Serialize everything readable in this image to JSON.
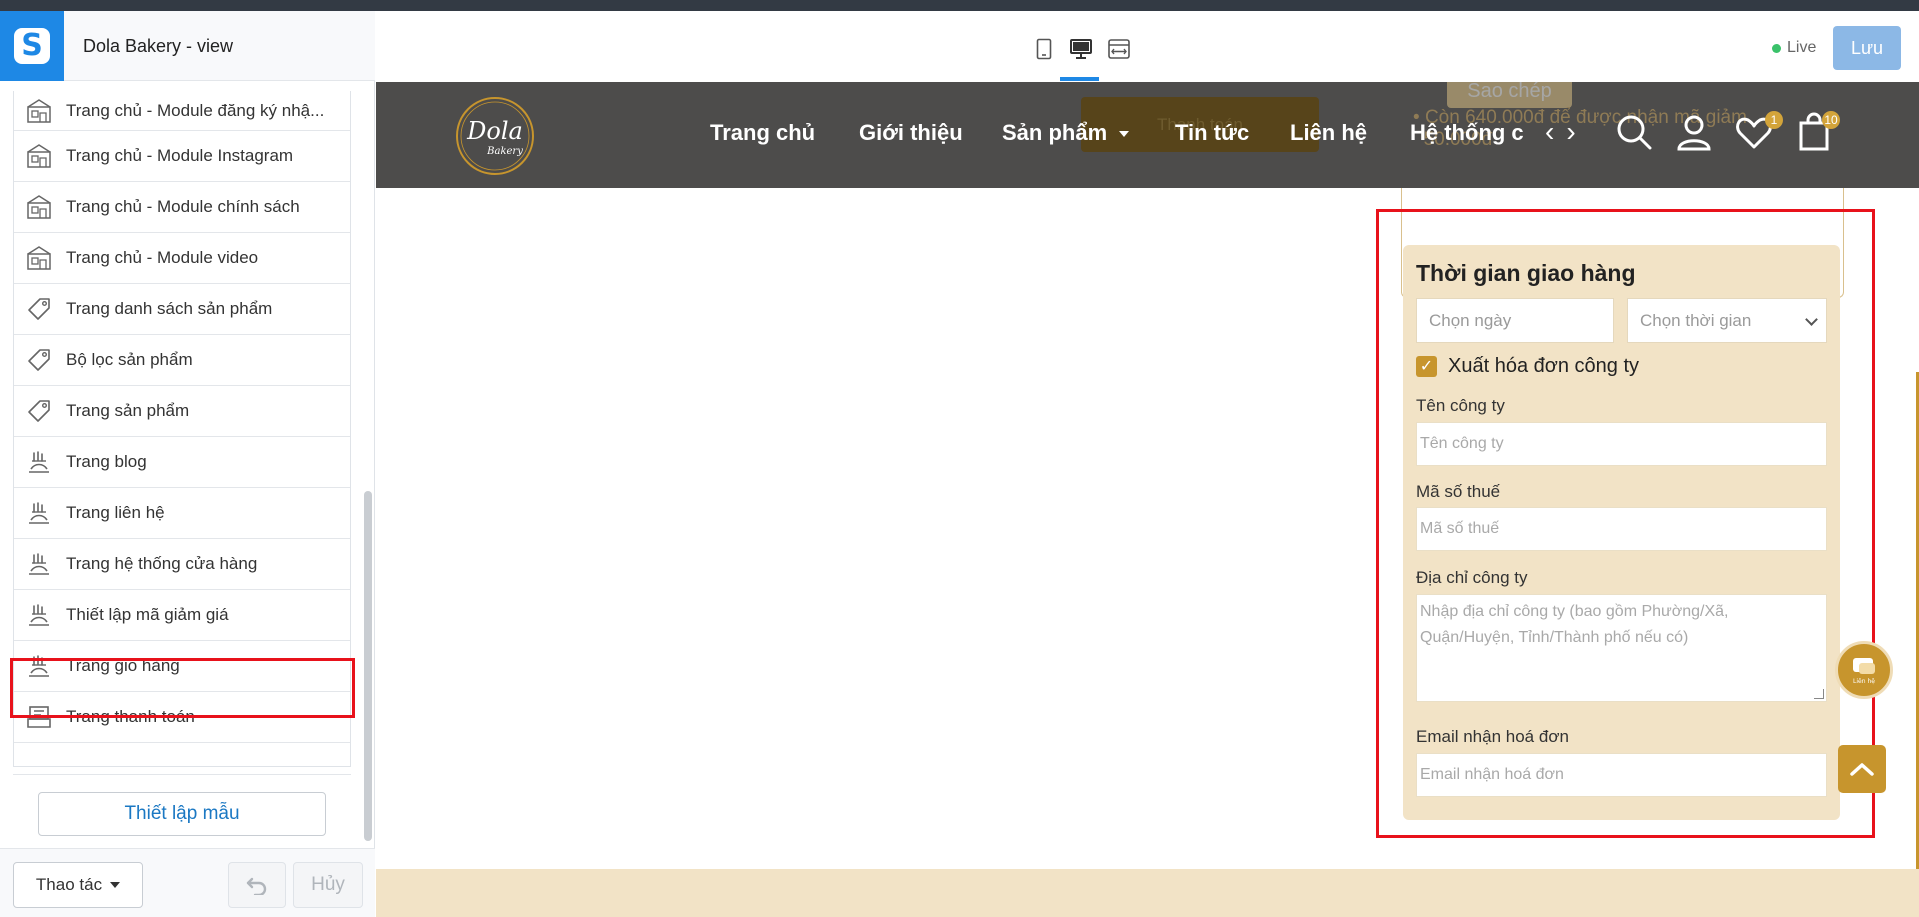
{
  "app": {
    "title": "Dola Bakery - view",
    "live_label": "Live",
    "save_label": "Lưu"
  },
  "sidebar": {
    "items": [
      {
        "label": "Trang chủ - Module đăng ký nhậ...",
        "icon": "home-icon"
      },
      {
        "label": "Trang chủ - Module Instagram",
        "icon": "home-icon"
      },
      {
        "label": "Trang chủ - Module chính sách",
        "icon": "home-icon"
      },
      {
        "label": "Trang chủ - Module video",
        "icon": "home-icon"
      },
      {
        "label": "Trang danh sách sản phẩm",
        "icon": "tag-icon"
      },
      {
        "label": "Bộ lọc sản phẩm",
        "icon": "tag-icon"
      },
      {
        "label": "Trang sản phẩm",
        "icon": "tag-icon"
      },
      {
        "label": "Trang blog",
        "icon": "blog-icon"
      },
      {
        "label": "Trang liên hệ",
        "icon": "blog-icon"
      },
      {
        "label": "Trang hệ thống cửa hàng",
        "icon": "blog-icon"
      },
      {
        "label": "Thiết lập mã giảm giá",
        "icon": "blog-icon"
      },
      {
        "label": "Trang giỏ hàng",
        "icon": "blog-icon"
      },
      {
        "label": "Trang thanh toán",
        "icon": "checkout-icon"
      }
    ],
    "template_button": "Thiết lập mẫu",
    "action_button": "Thao tác",
    "cancel_button": "Hủy"
  },
  "store": {
    "logo_text": "Dola",
    "logo_sub": "Bakery",
    "nav": [
      "Trang chủ",
      "Giới thiệu",
      "Sản phẩm",
      "Tin tức",
      "Liên hệ",
      "Hệ thống c"
    ],
    "wishlist_count": "1",
    "cart_count": "10",
    "ghost_button": "Thanh toán",
    "ghost_copy": "Sao chép",
    "ghost_line1": "Còn 640.000đ để được nhận mã giảm",
    "ghost_line2": "50.000đ"
  },
  "delivery": {
    "title": "Thời gian giao hàng",
    "date_placeholder": "Chọn ngày",
    "time_placeholder": "Chọn thời gian",
    "invoice_label": "Xuất hóa đơn công ty",
    "company_label": "Tên công ty",
    "company_placeholder": "Tên công ty",
    "tax_label": "Mã số thuế",
    "tax_placeholder": "Mã số thuế",
    "address_label": "Địa chỉ công ty",
    "address_placeholder": "Nhập địa chỉ công ty (bao gồm Phường/Xã, Quận/Huyện, Tỉnh/Thành phố nếu có)",
    "email_label": "Email nhận hoá đơn",
    "email_placeholder": "Email nhận hoá đơn"
  },
  "chat_label": "Liên hệ",
  "colors": {
    "accent": "#1e88e5",
    "brand_gold": "#c7952d",
    "panel_bg": "#f2e3c6",
    "highlight": "#e8121b"
  }
}
